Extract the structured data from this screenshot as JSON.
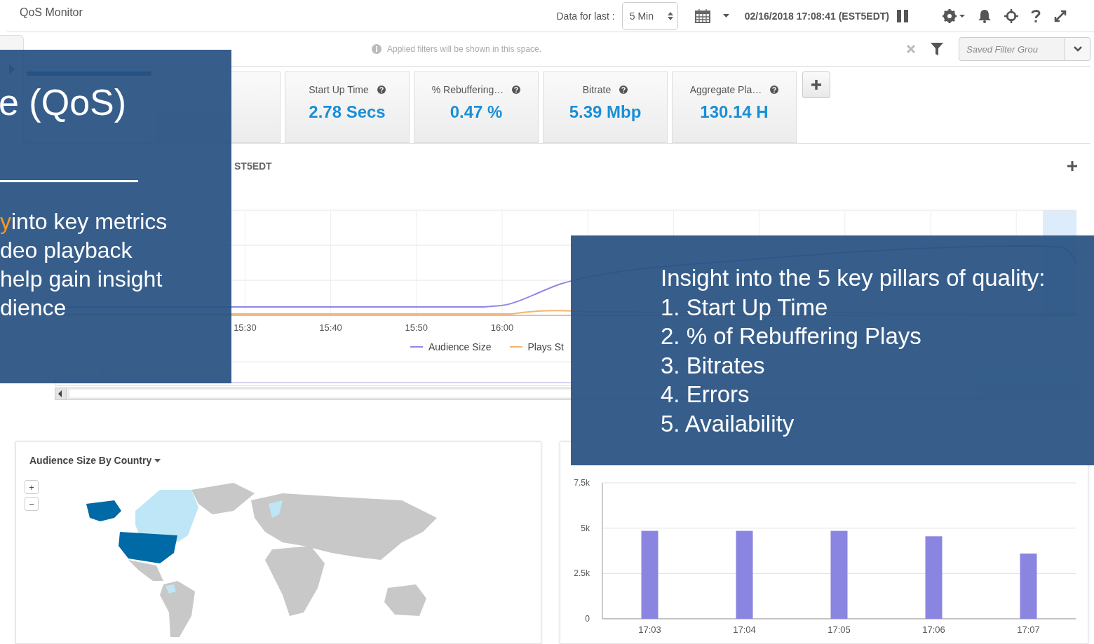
{
  "app": {
    "title": "QoS Monitor"
  },
  "toolbar": {
    "range_label": "Data for last :",
    "range_value": "5 Min",
    "timestamp": "02/16/2018 17:08:41 (EST5EDT)"
  },
  "filter_bar": {
    "hint": "Applied filters will be shown in this space.",
    "saved_filter": {
      "placeholder": "Saved Filter Grou"
    }
  },
  "metrics": [
    {
      "selected": true
    },
    {
      "selected": false
    },
    {
      "label": "Start Up Time",
      "value": "2.78 Secs",
      "selected": false
    },
    {
      "label": "% Rebuffering…",
      "value": "0.47 %",
      "selected": false
    },
    {
      "label": "Bitrate",
      "value": "5.39 Mbp",
      "selected": false
    },
    {
      "label": "Aggregate Pla…",
      "value": "130.14 H",
      "selected": false
    }
  ],
  "range_text": "ST5EDT",
  "line_chart": {
    "x_labels": [
      "15:30",
      "15:40",
      "15:50",
      "16:00"
    ],
    "legend": [
      {
        "name": "Audience Size",
        "color": "#8f86e6"
      },
      {
        "name": "Plays St",
        "color": "#f5b56a"
      }
    ]
  },
  "map_card": {
    "title": "Audience Size By Country",
    "zoom_in": "+",
    "zoom_out": "−"
  },
  "bar_card": {
    "chart_data": {
      "type": "bar",
      "categories": [
        "17:03",
        "17:04",
        "17:05",
        "17:06",
        "17:07"
      ],
      "series": [
        {
          "color": "#8a85e0",
          "values": [
            4850,
            4850,
            4850,
            4550,
            3600
          ]
        }
      ],
      "ylim": [
        0,
        7500
      ],
      "yticks": [
        {
          "value": 0,
          "label": "0"
        },
        {
          "value": 2500,
          "label": "2.5k"
        },
        {
          "value": 5000,
          "label": "5k"
        },
        {
          "value": 7500,
          "label": "7.5k"
        }
      ]
    }
  },
  "slide_left": {
    "title": "e (QoS)",
    "bullets": [
      {
        "highlight": "y",
        "text": "into key metrics"
      },
      {
        "text": "deo playback"
      },
      {
        "text": "help gain insight"
      },
      {
        "text": "dience"
      }
    ]
  },
  "slide_right": {
    "heading": "Insight into the 5 key pillars of quality:",
    "items": [
      "1. Start Up Time",
      "2. % of Rebuffering Plays",
      "3. Bitrates",
      "4. Errors",
      "5. Availability"
    ]
  }
}
